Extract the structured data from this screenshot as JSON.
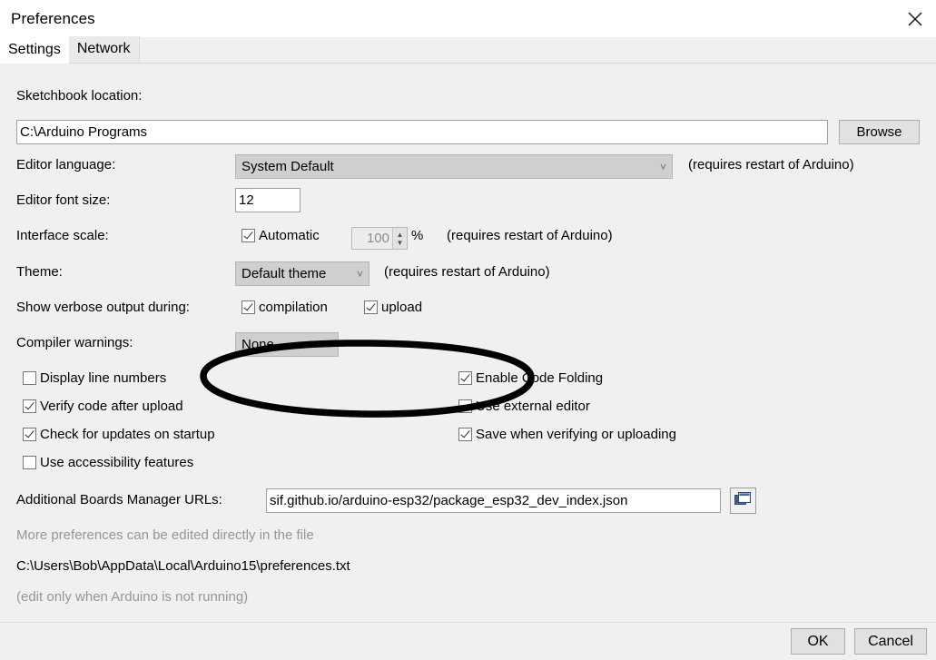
{
  "window": {
    "title": "Preferences",
    "close_icon": "close-icon"
  },
  "tabs": [
    {
      "label": "Settings",
      "active": true
    },
    {
      "label": "Network",
      "active": false
    }
  ],
  "settings": {
    "sketchbook": {
      "label": "Sketchbook location:",
      "value": "C:\\Arduino Programs",
      "browse_label": "Browse"
    },
    "editor_language": {
      "label": "Editor language:",
      "value": "System Default",
      "note": "(requires restart of Arduino)"
    },
    "editor_font_size": {
      "label": "Editor font size:",
      "value": "12"
    },
    "interface_scale": {
      "label": "Interface scale:",
      "automatic_label": "Automatic",
      "automatic_checked": true,
      "scale_value": "100",
      "percent_symbol": "%",
      "note": "(requires restart of Arduino)"
    },
    "theme": {
      "label": "Theme:",
      "value": "Default theme",
      "note": "(requires restart of Arduino)"
    },
    "verbose_output": {
      "label": "Show verbose output during:",
      "compilation_label": "compilation",
      "compilation_checked": true,
      "upload_label": "upload",
      "upload_checked": true
    },
    "compiler_warnings": {
      "label": "Compiler warnings:",
      "value": "None"
    },
    "checkboxes_left": [
      {
        "label": "Display line numbers",
        "checked": false
      },
      {
        "label": "Verify code after upload",
        "checked": true
      },
      {
        "label": "Check for updates on startup",
        "checked": true
      },
      {
        "label": "Use accessibility features",
        "checked": false
      }
    ],
    "checkboxes_right": [
      {
        "label": "Enable Code Folding",
        "checked": true
      },
      {
        "label": "Use external editor",
        "checked": false
      },
      {
        "label": "Save when verifying or uploading",
        "checked": true
      }
    ],
    "boards_urls": {
      "label": "Additional Boards Manager URLs:",
      "value": "sif.github.io/arduino-esp32/package_esp32_dev_index.json",
      "edit_icon": "windows-copy-icon"
    },
    "more_prefs_line1": "More preferences can be edited directly in the file",
    "more_prefs_path": "C:\\Users\\Bob\\AppData\\Local\\Arduino15\\preferences.txt",
    "more_prefs_line3": "(edit only when Arduino is not running)"
  },
  "footer": {
    "ok_label": "OK",
    "cancel_label": "Cancel"
  },
  "annotation": {
    "shape": "ellipse-highlight",
    "color": "#000000"
  }
}
